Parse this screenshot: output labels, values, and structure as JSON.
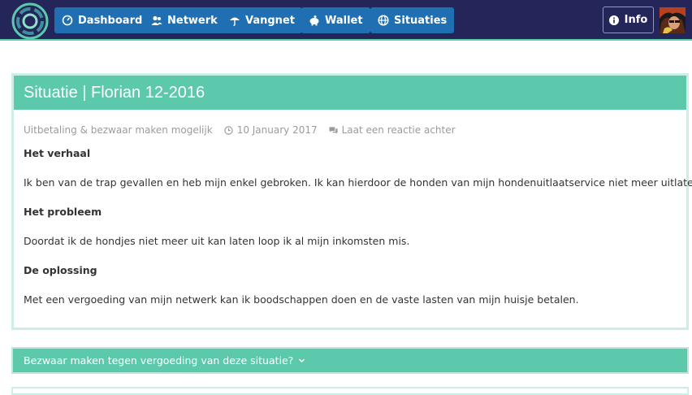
{
  "nav": {
    "items": [
      {
        "label": "Dashboard",
        "icon": "dashboard-icon"
      },
      {
        "label": "Netwerk",
        "icon": "users-icon"
      },
      {
        "label": "Vangnet",
        "icon": "umbrella-icon"
      },
      {
        "label": "Wallet",
        "icon": "piggy-bank-icon"
      },
      {
        "label": "Situaties",
        "icon": "globe-icon"
      }
    ],
    "info_label": "Info"
  },
  "situation": {
    "title": "Situatie | Florian 12-2016",
    "meta": {
      "category": "Uitbetaling & bezwaar maken mogelijk",
      "date": "10 January 2017",
      "comment_link": "Laat een reactie achter"
    },
    "sections": [
      {
        "heading": "Het verhaal",
        "text": "Ik ben van de trap gevallen en heb mijn enkel gebroken. Ik kan hierdoor de honden van mijn hondenuitlaatservice niet meer uitlaten."
      },
      {
        "heading": "Het probleem",
        "text": "Doordat ik de hondjes niet meer uit kan laten loop ik al mijn inkomsten mis."
      },
      {
        "heading": "De oplossing",
        "text": "Met een vergoeding van mijn netwerk kan ik boodschappen doen en de vaste lasten van mijn huisje betalen."
      }
    ]
  },
  "objection": {
    "label": "Bezwaar maken tegen vergoeding van deze situatie?"
  },
  "colors": {
    "navbar": "#24265a",
    "nav_button": "#1f6fb2",
    "accent": "#5cc8ac",
    "text": "#333333",
    "muted": "#9b9b9b"
  }
}
